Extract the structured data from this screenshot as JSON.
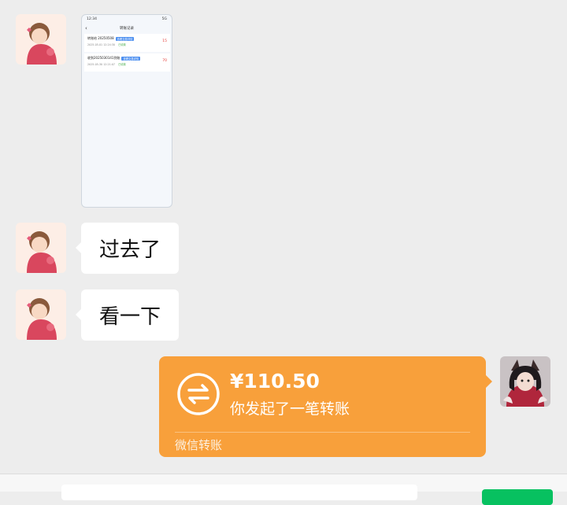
{
  "messages": [
    {
      "type": "image",
      "screenshot": {
        "status_time": "12:34",
        "status_right": "5G",
        "title": "转账记录",
        "records": [
          {
            "name": "转账给 20250508",
            "tag": "查看交易详情",
            "time": "2025-05-01 12:24:30",
            "status": "已收款",
            "amount": "15"
          },
          {
            "name": "收到2025030141到账",
            "tag": "查看交易详情",
            "time": "2025-05-30 12:21:07",
            "status": "已收款",
            "amount": "70"
          }
        ]
      }
    },
    {
      "type": "text",
      "text": "过去了"
    },
    {
      "type": "text",
      "text": "看一下"
    },
    {
      "type": "transfer",
      "amount": "¥110.50",
      "subtitle": "你发起了一笔转账",
      "footer": "微信转账"
    }
  ],
  "colors": {
    "background": "#ededed",
    "transfer": "#f8a03b",
    "send_button": "#07c160"
  },
  "icons": [
    "avatar-cartoon-boy",
    "transfer-arrows-icon",
    "avatar-fox-girl",
    "back-arrow-icon"
  ]
}
